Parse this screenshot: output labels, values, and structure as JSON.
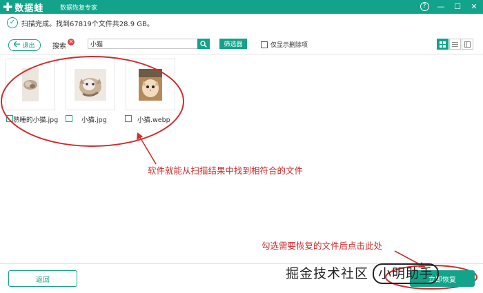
{
  "app": {
    "name": "数据蛙",
    "subtitle": "数据恢复专家"
  },
  "window": {
    "help_label": "?",
    "minimize_label": "—",
    "maximize_label": "☐",
    "close_label": "✕"
  },
  "status": {
    "text": "扫描完成。找到67819个文件共28.9 GB。"
  },
  "toolbar": {
    "back_label": "退出",
    "search_label": "搜索",
    "search_value": "小猫",
    "filter_label": "筛选器",
    "deleted_only_label": "仅显示删除项"
  },
  "files": [
    {
      "name": "熟睡的小猫.jpg"
    },
    {
      "name": "小猫.jpg"
    },
    {
      "name": "小猫.webp"
    }
  ],
  "annotations": {
    "found_text": "软件就能从扫描结果中找到相符合的文件",
    "check_text": "勾选需要恢复的文件后点击此处"
  },
  "footer": {
    "return_label": "返回",
    "recover_label": "立即恢复"
  },
  "watermark": {
    "left": "掘金技术社区",
    "right": "小明助手"
  },
  "colors": {
    "brand": "#12a38a",
    "annotation": "#d42a2a",
    "clear": "#e04848"
  }
}
